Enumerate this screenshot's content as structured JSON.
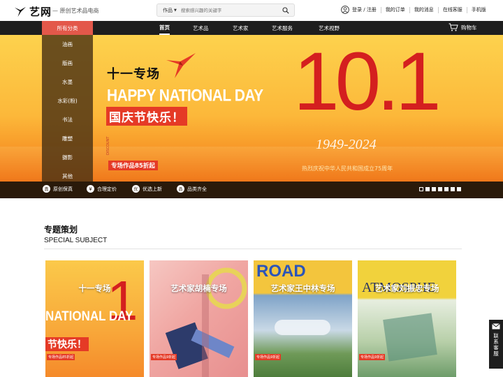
{
  "header": {
    "logo_text": "艺网",
    "slogan": "— 原创艺术品电商",
    "search": {
      "type_label": "作品",
      "placeholder": "搜索感兴趣的关键字"
    },
    "login_label": "登录 / 注册",
    "links": [
      "我的订单",
      "我的消息",
      "在线客服",
      "手机版"
    ]
  },
  "nav": {
    "category_label": "所有分类",
    "items": [
      "首页",
      "艺术品",
      "艺术家",
      "艺术服务",
      "艺术视野"
    ],
    "active_index": 0,
    "cart_label": "购物车"
  },
  "side_menu": [
    "油画",
    "版画",
    "水墨",
    "水彩(粉)",
    "书法",
    "雕塑",
    "摄影",
    "其他"
  ],
  "banner": {
    "title_cn": "十一专场",
    "title_en": "HAPPY NATIONAL DAY",
    "title_fest": "国庆节快乐！",
    "discount_tag": "DISCOUNT",
    "promo": "专场作品85折起",
    "big_date": "10.1",
    "years": "1949-2024",
    "anniversary": "热烈庆祝中华人民共和国成立75周年",
    "slide_count": 7,
    "active_slide": 0
  },
  "features": [
    "原创保真",
    "合理定价",
    "优选上新",
    "品类齐全"
  ],
  "feature_icons": [
    "genuine-icon",
    "yen-icon",
    "select-icon",
    "category-icon"
  ],
  "special": {
    "title": "专题策划",
    "subtitle": "SPECIAL SUBJECT",
    "cards": [
      {
        "label": "十一专场",
        "tag": "专场作品85折起"
      },
      {
        "label": "艺术家胡楠专场",
        "tag": "专场作品9折起"
      },
      {
        "label": "艺术家王中林专场",
        "tag": "专场作品9折起"
      },
      {
        "label": "艺术家刘振忠专场",
        "tag": "专场作品9折起"
      }
    ]
  },
  "contact": {
    "label": "联系客服"
  },
  "colors": {
    "accent": "#e53a26",
    "nav_bg": "#1e1e1e",
    "category_bg": "#e3584a"
  }
}
